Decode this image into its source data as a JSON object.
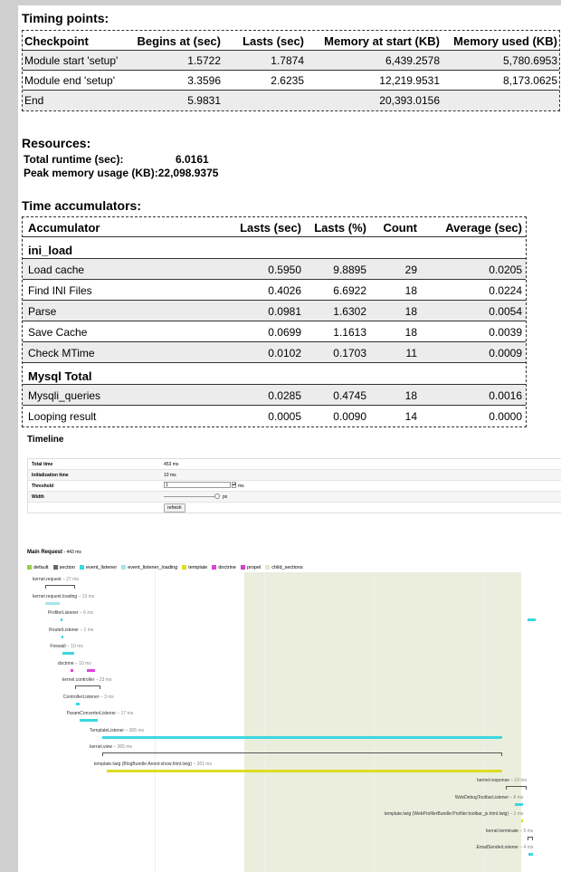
{
  "timing": {
    "title": "Timing points:",
    "headers": [
      "Checkpoint",
      "Begins at (sec)",
      "Lasts (sec)",
      "Memory at start (KB)",
      "Memory used (KB)"
    ],
    "rows": [
      [
        "Module start 'setup'",
        "1.5722",
        "1.7874",
        "6,439.2578",
        "5,780.6953"
      ],
      [
        "Module end 'setup'",
        "3.3596",
        "2.6235",
        "12,219.9531",
        "8,173.0625"
      ],
      [
        "End",
        "5.9831",
        "",
        "20,393.0156",
        ""
      ]
    ]
  },
  "resources": {
    "title": "Resources:",
    "runtime_label": "Total runtime (sec):",
    "runtime_value": "6.0161",
    "peak_label": "Peak memory usage (KB):",
    "peak_value": "22,098.9375"
  },
  "accum": {
    "title": "Time accumulators:",
    "headers": [
      "Accumulator",
      "Lasts (sec)",
      "Lasts (%)",
      "Count",
      "Average (sec)"
    ],
    "group1": "ini_load",
    "rows1": [
      [
        "Load cache",
        "0.5950",
        "9.8895",
        "29",
        "0.0205"
      ],
      [
        "Find INI Files",
        "0.4026",
        "6.6922",
        "18",
        "0.0224"
      ],
      [
        "Parse",
        "0.0981",
        "1.6302",
        "18",
        "0.0054"
      ],
      [
        "Save Cache",
        "0.0699",
        "1.1613",
        "18",
        "0.0039"
      ],
      [
        "Check MTime",
        "0.0102",
        "0.1703",
        "11",
        "0.0009"
      ]
    ],
    "group2": "Mysql Total",
    "rows2": [
      [
        "Mysqli_queries",
        "0.0285",
        "0.4745",
        "18",
        "0.0016"
      ],
      [
        "Looping result",
        "0.0005",
        "0.0090",
        "14",
        "0.0000"
      ]
    ]
  },
  "timeline": {
    "title": "Timeline",
    "config": [
      {
        "label": "Total time",
        "value": "453 ms"
      },
      {
        "label": "Initialization time",
        "value": "10 ms"
      },
      {
        "label": "Threshold",
        "value": "1",
        "unit": "ms"
      },
      {
        "label": "Width",
        "value": "",
        "unit": "px"
      },
      {
        "label": "",
        "value": "refresh"
      }
    ],
    "main_request_label": "Main Request",
    "main_request_time": " - 443 ms",
    "legend": [
      {
        "name": "default",
        "color": "#99cc44"
      },
      {
        "name": "section",
        "color": "#666666"
      },
      {
        "name": "event_listener",
        "color": "#3dd7e0"
      },
      {
        "name": "event_listener_loading",
        "color": "#a3e6e9"
      },
      {
        "name": "template",
        "color": "#dddd22"
      },
      {
        "name": "doctrine",
        "color": "#dd44dd"
      },
      {
        "name": "propel",
        "color": "#cc44cc"
      },
      {
        "name": "child_sections",
        "color": "#e8e5cf"
      }
    ],
    "events": [
      {
        "name": "kernel.request",
        "dur": " – 27 ms",
        "start": 0,
        "len": 27,
        "color": "#666666",
        "section": true
      },
      {
        "name": "kernel.request.loading",
        "dur": " – 13 ms",
        "start": 0,
        "len": 13,
        "color": "#a3e6e9"
      },
      {
        "name": "ProfilerListener",
        "dur": " – 6 ms",
        "start": 14,
        "len": 1,
        "color": "#3dd7e0",
        "end": [
          440,
          7
        ]
      },
      {
        "name": "RouterListener",
        "dur": " – 1 ms",
        "start": 15,
        "len": 1,
        "color": "#3dd7e0"
      },
      {
        "name": "Firewall",
        "dur": " – 10 ms",
        "start": 16,
        "len": 10,
        "color": "#3dd7e0"
      },
      {
        "name": "doctrine",
        "dur": " – 10 ms",
        "start": 23,
        "len": 3,
        "color": "#dd44dd",
        "end": [
          38,
          7
        ]
      },
      {
        "name": "kernel.controller",
        "dur": " – 23 ms",
        "start": 27,
        "len": 23,
        "color": "#666666",
        "section": true
      },
      {
        "name": "ControllerListener",
        "dur": " – 3 ms",
        "start": 28,
        "len": 3,
        "color": "#3dd7e0"
      },
      {
        "name": "ParamConverterListener",
        "dur": " – 17 ms",
        "start": 31,
        "len": 17,
        "color": "#3dd7e0"
      },
      {
        "name": "TemplateListener",
        "dur": " – 365 ms",
        "start": 52,
        "len": 365,
        "color": "#3dd7e0"
      },
      {
        "name": "kernel.view",
        "dur": " – 365 ms",
        "start": 52,
        "len": 365,
        "color": "#666666",
        "section": true
      },
      {
        "name": "template.twig (BlogBundle:Annot:show.html.twig)",
        "dur": " – 361 ms",
        "start": 56,
        "len": 361,
        "color": "#dddd22"
      },
      {
        "name": "kernel.response",
        "dur": " – 19 ms",
        "start": 420,
        "len": 19,
        "color": "#666666",
        "section": true,
        "right": true
      },
      {
        "name": "WebDebugToolbarListener",
        "dur": " – 8 ms",
        "start": 428,
        "len": 8,
        "color": "#3dd7e0",
        "right": true
      },
      {
        "name": "template.twig (WebProfilerBundle:Profiler:toolbar_js.html.twig)",
        "dur": " – 2 ms",
        "start": 434,
        "len": 2,
        "color": "#dddd22",
        "right": true
      },
      {
        "name": "kernel.terminate",
        "dur": " – 5 ms",
        "start": 440,
        "len": 5,
        "color": "#666666",
        "section": true,
        "right": true
      },
      {
        "name": "EmailSenderListener",
        "dur": " – 4 ms",
        "start": 441,
        "len": 4,
        "color": "#3dd7e0",
        "right": true
      }
    ]
  }
}
